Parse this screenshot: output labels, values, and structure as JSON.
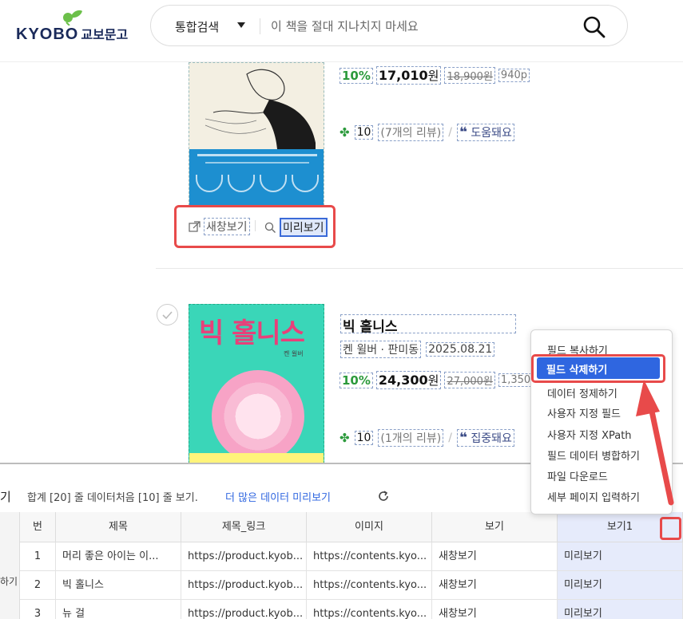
{
  "header": {
    "logo_brand": "KYOBO",
    "logo_kr": "교보문고",
    "search_category": "통합검색",
    "search_placeholder": "이 책을 절대 지나치지 마세요"
  },
  "book1": {
    "discount": "10%",
    "price": "17,010",
    "won": "원",
    "original_price": "18,900원",
    "points": "940p",
    "rating": "10",
    "review_count": "(7개의 리뷰)",
    "review_tag": "도움돼요",
    "action_newwindow": "새창보기",
    "action_preview": "미리보기"
  },
  "book2": {
    "cover_title": "빅 홀니스",
    "cover_author": "켄 윌버",
    "title": "빅 홀니스",
    "authors": "켄 윌버 · 판미동",
    "date": "2025.08.21",
    "discount": "10%",
    "price": "24,300",
    "won": "원",
    "original_price": "27,000원",
    "points": "1,350p",
    "rating": "10",
    "review_count": "(1개의 리뷰)",
    "review_tag": "집중돼요"
  },
  "context_menu": {
    "items": [
      "필드 복사하기",
      "필드 삭제하기",
      "데이터 정제하기",
      "사용자 지정 필드",
      "사용자 지정 XPath",
      "필드 데이터 병합하기",
      "파일 다운로드",
      "세부 페이지 입력하기"
    ],
    "active_index": 1
  },
  "panel": {
    "label": "기",
    "summary": "합계 [20] 줄 데이터처음 [10] 줄 보기.",
    "more_link": "더 많은 데이터 미리보기",
    "side_label": "하기",
    "columns": [
      "번",
      "제목",
      "제목_링크",
      "이미지",
      "보기",
      "보기1"
    ],
    "rows": [
      [
        "1",
        "머리 좋은 아이는 이...",
        "https://product.kyob...",
        "https://contents.kyo...",
        "새창보기",
        "미리보기"
      ],
      [
        "2",
        "빅 홀니스",
        "https://product.kyob...",
        "https://contents.kyo...",
        "새창보기",
        "미리보기"
      ],
      [
        "3",
        "뉴 걸",
        "https://product.kyob...",
        "https://contents.kyo...",
        "새창보기",
        "미리보기"
      ]
    ]
  },
  "colors": {
    "accent_red": "#e84a4a",
    "menu_blue": "#2f66e0",
    "discount_green": "#2c9a3c",
    "quote_navy": "#3a4a86"
  }
}
